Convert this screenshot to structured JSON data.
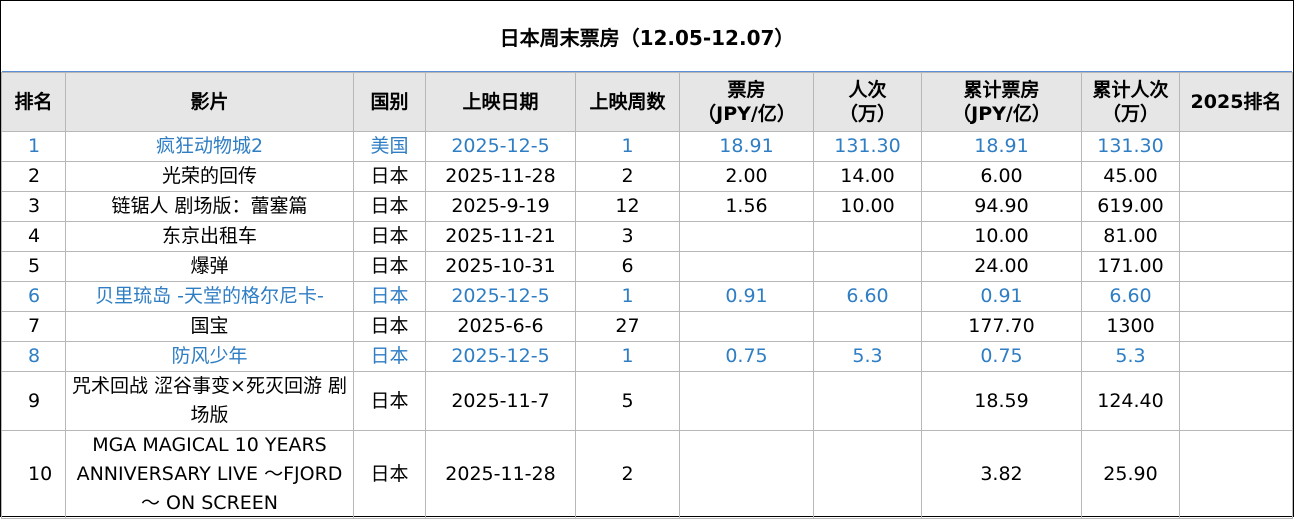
{
  "title": "日本周末票房（12.05-12.07）",
  "headers": [
    "排名",
    "影片",
    "国别",
    "上映日期",
    "上映周数",
    "票房\n（JPY/亿）",
    "人次\n（万）",
    "累计票房\n（JPY/亿）",
    "累计人次\n（万）",
    "2025排名"
  ],
  "colors": {
    "highlight": "#2f7ec4",
    "header_bg": "#e6e6e6",
    "title_rule": "#5b8fd6"
  },
  "rows": [
    {
      "rank": "1",
      "film": "疯狂动物城2",
      "country": "美国",
      "date": "2025-12-5",
      "weeks": "1",
      "box": "18.91",
      "adm": "131.30",
      "cum_box": "18.91",
      "cum_adm": "131.30",
      "rank2025": "",
      "new": true
    },
    {
      "rank": "2",
      "film": "光荣的回传",
      "country": "日本",
      "date": "2025-11-28",
      "weeks": "2",
      "box": "2.00",
      "adm": "14.00",
      "cum_box": "6.00",
      "cum_adm": "45.00",
      "rank2025": "",
      "new": false
    },
    {
      "rank": "3",
      "film": "链锯人 剧场版：蕾塞篇",
      "country": "日本",
      "date": "2025-9-19",
      "weeks": "12",
      "box": "1.56",
      "adm": "10.00",
      "cum_box": "94.90",
      "cum_adm": "619.00",
      "rank2025": "",
      "new": false
    },
    {
      "rank": "4",
      "film": "东京出租车",
      "country": "日本",
      "date": "2025-11-21",
      "weeks": "3",
      "box": "",
      "adm": "",
      "cum_box": "10.00",
      "cum_adm": "81.00",
      "rank2025": "",
      "new": false
    },
    {
      "rank": "5",
      "film": "爆弹",
      "country": "日本",
      "date": "2025-10-31",
      "weeks": "6",
      "box": "",
      "adm": "",
      "cum_box": "24.00",
      "cum_adm": "171.00",
      "rank2025": "",
      "new": false
    },
    {
      "rank": "6",
      "film": "贝里琉岛 -天堂的格尔尼卡-",
      "country": "日本",
      "date": "2025-12-5",
      "weeks": "1",
      "box": "0.91",
      "adm": "6.60",
      "cum_box": "0.91",
      "cum_adm": "6.60",
      "rank2025": "",
      "new": true
    },
    {
      "rank": "7",
      "film": "国宝",
      "country": "日本",
      "date": "2025-6-6",
      "weeks": "27",
      "box": "",
      "adm": "",
      "cum_box": "177.70",
      "cum_adm": "1300",
      "rank2025": "",
      "new": false
    },
    {
      "rank": "8",
      "film": "防风少年",
      "country": "日本",
      "date": "2025-12-5",
      "weeks": "1",
      "box": "0.75",
      "adm": "5.3",
      "cum_box": "0.75",
      "cum_adm": "5.3",
      "rank2025": "",
      "new": true
    },
    {
      "rank": "9",
      "film": "咒术回战 涩谷事变×死灭回游 剧场版",
      "country": "日本",
      "date": "2025-11-7",
      "weeks": "5",
      "box": "",
      "adm": "",
      "cum_box": "18.59",
      "cum_adm": "124.40",
      "rank2025": "",
      "new": false,
      "lines": 2
    },
    {
      "rank": "10",
      "film": "MGA MAGICAL 10 YEARS ANNIVERSARY LIVE ～FJORD～ ON SCREEN",
      "country": "日本",
      "date": "2025-11-28",
      "weeks": "2",
      "box": "",
      "adm": "",
      "cum_box": "3.82",
      "cum_adm": "25.90",
      "rank2025": "",
      "new": false,
      "lines": 3
    }
  ]
}
